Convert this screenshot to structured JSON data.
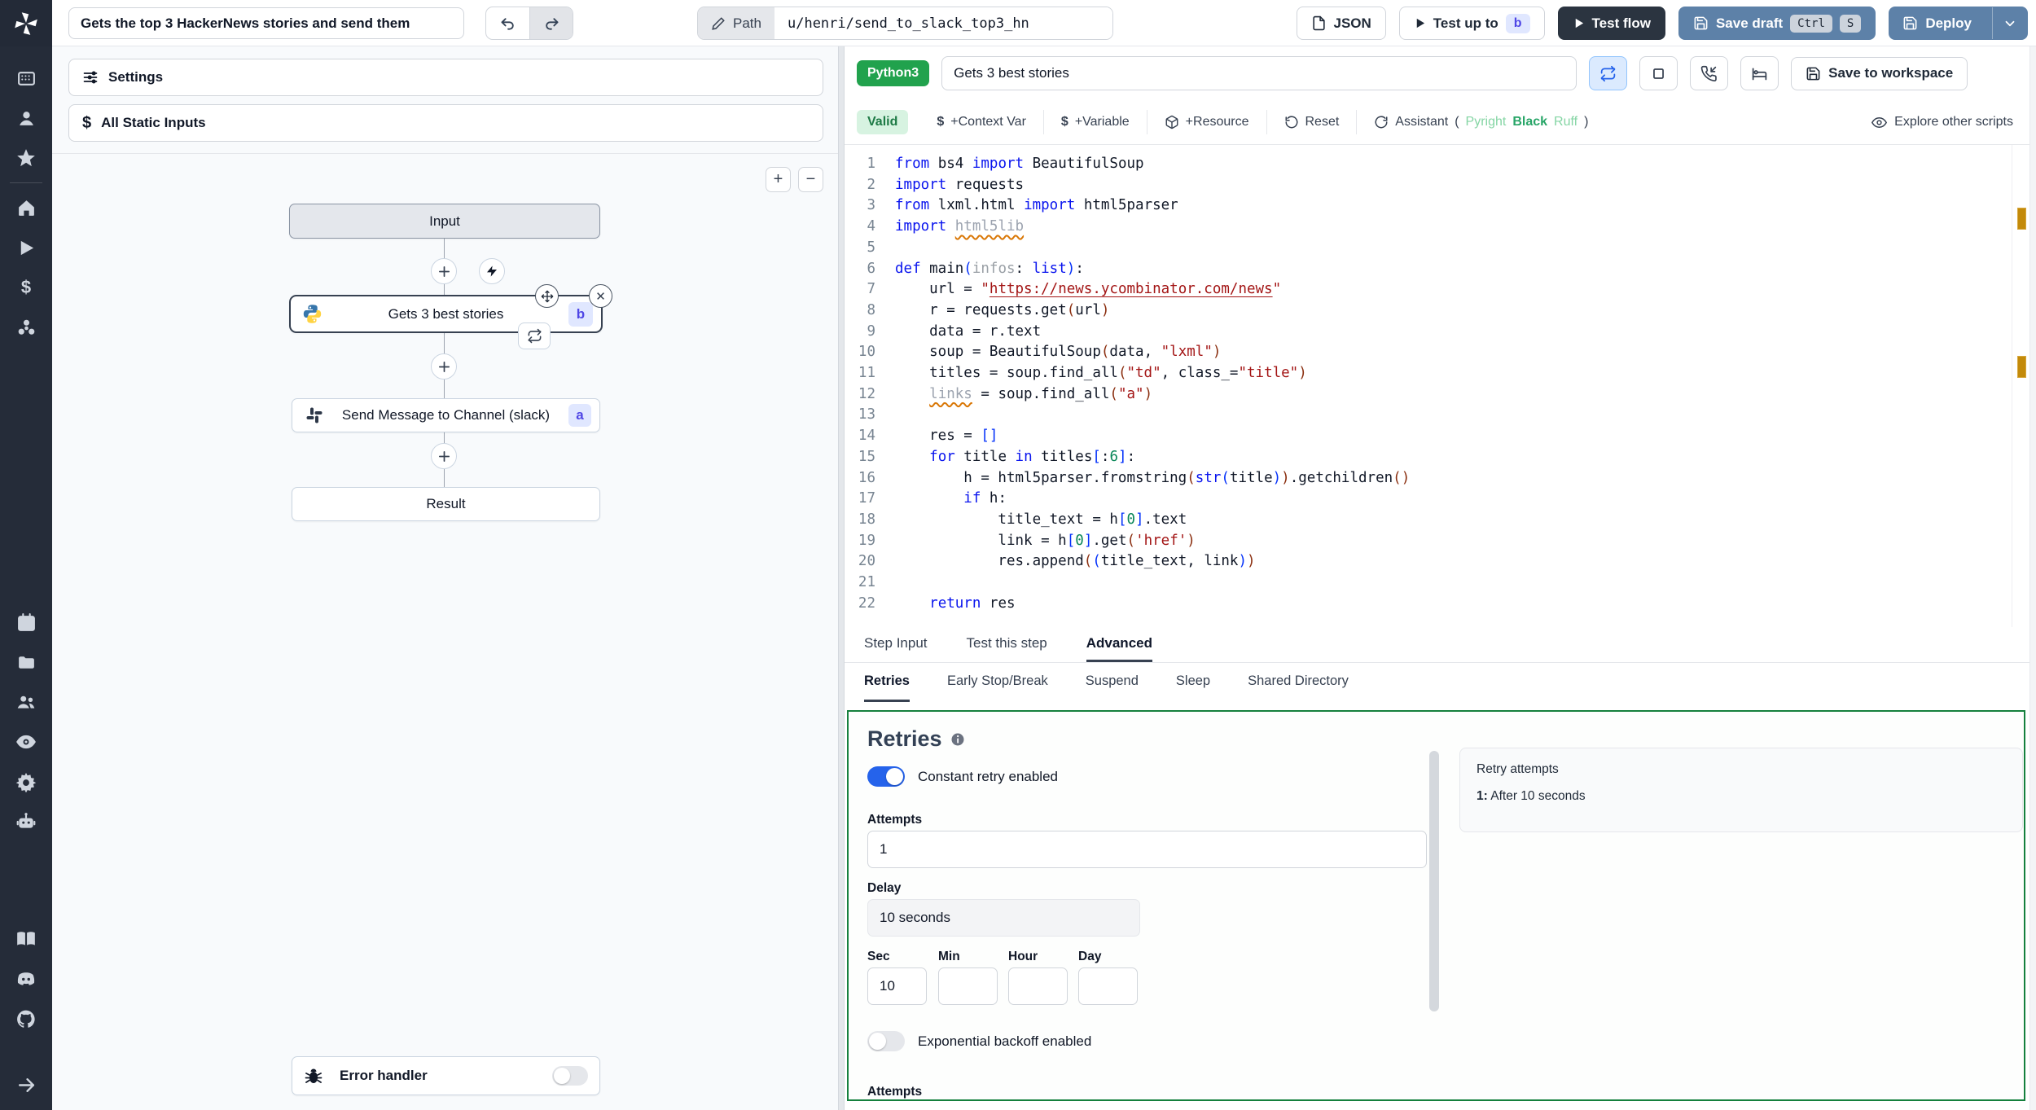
{
  "topbar": {
    "flow_title": "Gets the top 3 HackerNews stories and send them",
    "path_label": "Path",
    "path_value": "u/henri/send_to_slack_top3_hn",
    "json_label": "JSON",
    "test_up_to_label": "Test up to",
    "test_up_to_badge": "b",
    "test_flow_label": "Test flow",
    "save_draft_label": "Save draft",
    "kbd_ctrl": "Ctrl",
    "kbd_s": "S",
    "deploy_label": "Deploy"
  },
  "sidebar": {
    "icons": [
      "workspace",
      "user",
      "favorites",
      "home",
      "runs",
      "variables",
      "resources",
      "schedules",
      "folders",
      "groups",
      "audit-logs",
      "settings",
      "workers",
      "docs",
      "discord",
      "github",
      "expand"
    ]
  },
  "flow_panel": {
    "settings_label": "Settings",
    "static_inputs_label": "All Static Inputs",
    "zoom_in": "+",
    "zoom_out": "−",
    "nodes": {
      "input_label": "Input",
      "step_b_title": "Gets 3 best stories",
      "step_b_badge": "b",
      "step_a_title": "Send Message to Channel (slack)",
      "step_a_badge": "a",
      "result_label": "Result",
      "error_handler_label": "Error handler"
    },
    "icons": {
      "close": "✕",
      "plus": "+"
    }
  },
  "editor": {
    "lang_badge": "Python3",
    "name_value": "Gets 3 best stories",
    "save_to_workspace": "Save to workspace",
    "valid_badge": "Valid",
    "actions": {
      "dollar": "$",
      "context_var": "+Context Var",
      "variable": "+Variable",
      "resource": "+Resource",
      "reset": "Reset",
      "assistant": "Assistant",
      "assistant_open": "(",
      "assistant_pyright": "Pyright",
      "assistant_black": "Black",
      "assistant_ruff": "Ruff",
      "assistant_close": ")",
      "explore": "Explore other scripts"
    },
    "code": {
      "language": "python",
      "lines": [
        [
          {
            "t": "from",
            "c": "k"
          },
          {
            "t": " bs4 "
          },
          {
            "t": "import",
            "c": "k"
          },
          {
            "t": " BeautifulSoup"
          }
        ],
        [
          {
            "t": "import",
            "c": "k"
          },
          {
            "t": " requests"
          }
        ],
        [
          {
            "t": "from",
            "c": "k"
          },
          {
            "t": " lxml.html "
          },
          {
            "t": "import",
            "c": "k"
          },
          {
            "t": " html5parser"
          }
        ],
        [
          {
            "t": "import",
            "c": "k"
          },
          {
            "t": " "
          },
          {
            "t": "html5lib",
            "c": "g"
          }
        ],
        [],
        [
          {
            "t": "def",
            "c": "k"
          },
          {
            "t": " main"
          },
          {
            "t": "(",
            "c": "b"
          },
          {
            "t": "infos",
            "c": "p"
          },
          {
            "t": ": "
          },
          {
            "t": "list",
            "c": "k"
          },
          {
            "t": ")",
            "c": "b"
          },
          {
            "t": ":"
          }
        ],
        [
          {
            "t": "    url = "
          },
          {
            "t": "\"",
            "c": "s"
          },
          {
            "t": "https://news.ycombinator.com/news",
            "c": "su"
          },
          {
            "t": "\"",
            "c": "s"
          }
        ],
        [
          {
            "t": "    r = requests.get"
          },
          {
            "t": "(",
            "c": "r"
          },
          {
            "t": "url"
          },
          {
            "t": ")",
            "c": "r"
          }
        ],
        [
          {
            "t": "    data = r.text"
          }
        ],
        [
          {
            "t": "    soup = BeautifulSoup"
          },
          {
            "t": "(",
            "c": "r"
          },
          {
            "t": "data, "
          },
          {
            "t": "\"lxml\"",
            "c": "s"
          },
          {
            "t": ")",
            "c": "r"
          }
        ],
        [
          {
            "t": "    titles = soup.find_all"
          },
          {
            "t": "(",
            "c": "r"
          },
          {
            "t": "\"td\"",
            "c": "s"
          },
          {
            "t": ", class_="
          },
          {
            "t": "\"title\"",
            "c": "s"
          },
          {
            "t": ")",
            "c": "r"
          }
        ],
        [
          {
            "t": "    "
          },
          {
            "t": "links",
            "c": "g"
          },
          {
            "t": " = soup.find_all"
          },
          {
            "t": "(",
            "c": "r"
          },
          {
            "t": "\"a\"",
            "c": "s"
          },
          {
            "t": ")",
            "c": "r"
          }
        ],
        [],
        [
          {
            "t": "    res = "
          },
          {
            "t": "[]",
            "c": "b"
          }
        ],
        [
          {
            "t": "    "
          },
          {
            "t": "for",
            "c": "k"
          },
          {
            "t": " title "
          },
          {
            "t": "in",
            "c": "k"
          },
          {
            "t": " titles"
          },
          {
            "t": "[",
            "c": "b"
          },
          {
            "t": ":"
          },
          {
            "t": "6",
            "c": "n"
          },
          {
            "t": "]",
            "c": "b"
          },
          {
            "t": ":"
          }
        ],
        [
          {
            "t": "        h = html5parser.fromstring"
          },
          {
            "t": "(",
            "c": "r"
          },
          {
            "t": "str",
            "c": "k"
          },
          {
            "t": "(",
            "c": "b"
          },
          {
            "t": "title"
          },
          {
            "t": ")",
            "c": "b"
          },
          {
            "t": ")",
            "c": "r"
          },
          {
            "t": ".getchildren"
          },
          {
            "t": "()",
            "c": "r"
          }
        ],
        [
          {
            "t": "        "
          },
          {
            "t": "if",
            "c": "k"
          },
          {
            "t": " h:"
          }
        ],
        [
          {
            "t": "            title_text = h"
          },
          {
            "t": "[",
            "c": "b"
          },
          {
            "t": "0",
            "c": "n"
          },
          {
            "t": "]",
            "c": "b"
          },
          {
            "t": ".text"
          }
        ],
        [
          {
            "t": "            link = h"
          },
          {
            "t": "[",
            "c": "b"
          },
          {
            "t": "0",
            "c": "n"
          },
          {
            "t": "]",
            "c": "b"
          },
          {
            "t": ".get"
          },
          {
            "t": "(",
            "c": "r"
          },
          {
            "t": "'href'",
            "c": "s"
          },
          {
            "t": ")",
            "c": "r"
          }
        ],
        [
          {
            "t": "            res.append"
          },
          {
            "t": "(",
            "c": "r"
          },
          {
            "t": "(",
            "c": "b"
          },
          {
            "t": "title_text, link"
          },
          {
            "t": ")",
            "c": "b"
          },
          {
            "t": ")",
            "c": "r"
          }
        ],
        [],
        [
          {
            "t": "    "
          },
          {
            "t": "return",
            "c": "k"
          },
          {
            "t": " res"
          }
        ]
      ]
    }
  },
  "tabs": {
    "step_input": "Step Input",
    "test_this_step": "Test this step",
    "advanced": "Advanced"
  },
  "subtabs": {
    "retries": "Retries",
    "early_stop": "Early Stop/Break",
    "suspend": "Suspend",
    "sleep": "Sleep",
    "shared_directory": "Shared Directory"
  },
  "retries": {
    "heading": "Retries",
    "constant_label": "Constant retry enabled",
    "attempts_label": "Attempts",
    "attempts_value": "1",
    "delay_label": "Delay",
    "delay_value": "10 seconds",
    "sec_label": "Sec",
    "sec_value": "10",
    "min_label": "Min",
    "hour_label": "Hour",
    "day_label": "Day",
    "backoff_label": "Exponential backoff enabled",
    "attempts2_label": "Attempts",
    "summary_title": "Retry attempts",
    "summary_prefix": "1:",
    "summary_text": " After 10 seconds"
  },
  "colors": {
    "accent_green_border": "#15803d",
    "toggle_blue": "#2563eb",
    "steel_blue_button": "#5d81a8",
    "dark_button": "#2b3440",
    "lang_badge_green": "#21a24d",
    "valid_badge_bg": "#d7f3e1",
    "indigo_badge_bg": "#e0e7ff",
    "indigo_badge_text": "#4f46e5",
    "sidebar_bg": "#252c39",
    "warning_mark": "#c38a0a"
  }
}
